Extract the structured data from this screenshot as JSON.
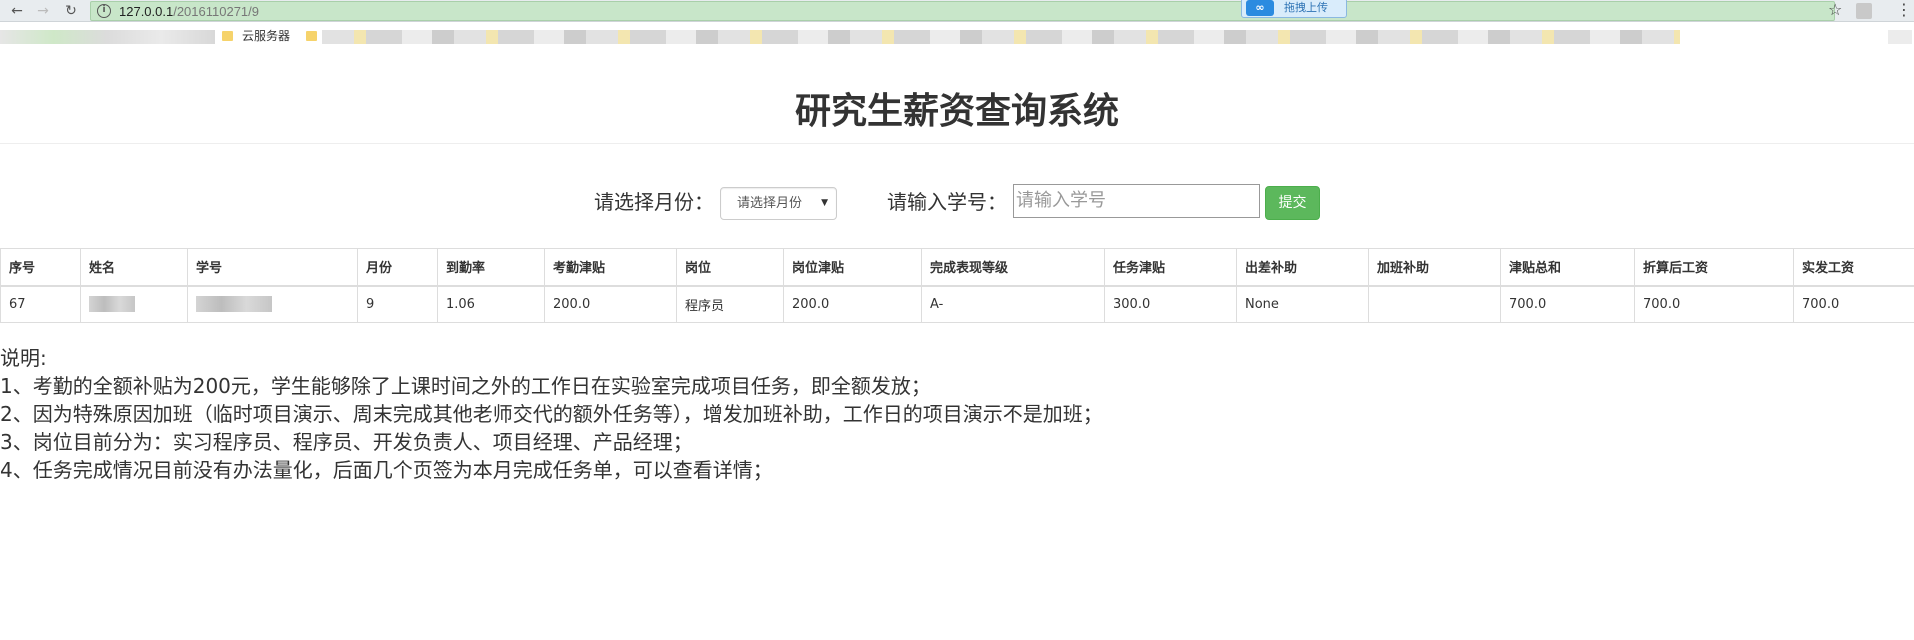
{
  "browser": {
    "url_host": "127.0.0.1",
    "url_path": "/2016110271/9",
    "upload_label": "拖拽上传",
    "bookmark_label": "云服务器"
  },
  "page": {
    "title": "研究生薪资查询系统"
  },
  "filter": {
    "month_label": "请选择月份：",
    "month_select_value": "请选择月份",
    "id_label": "请输入学号：",
    "id_placeholder": "请输入学号",
    "submit_label": "提交"
  },
  "table": {
    "headers": [
      "序号",
      "姓名",
      "学号",
      "月份",
      "到勤率",
      "考勤津贴",
      "岗位",
      "岗位津贴",
      "完成表现等级",
      "任务津贴",
      "出差补助",
      "加班补助",
      "津贴总和",
      "折算后工资",
      "实发工资"
    ],
    "rows": [
      [
        "67",
        "",
        "",
        "9",
        "1.06",
        "200.0",
        "程序员",
        "200.0",
        "A-",
        "300.0",
        "None",
        "",
        "700.0",
        "700.0",
        "700.0"
      ]
    ]
  },
  "notes": {
    "heading": "说明:",
    "items": [
      "1、考勤的全额补贴为200元，学生能够除了上课时间之外的工作日在实验室完成项目任务，即全额发放；",
      "2、因为特殊原因加班（临时项目演示、周末完成其他老师交代的额外任务等），增发加班补助，工作日的项目演示不是加班；",
      "3、岗位目前分为：实习程序员、程序员、开发负责人、项目经理、产品经理；",
      "4、任务完成情况目前没有办法量化，后面几个页签为本月完成任务单，可以查看详情；"
    ]
  }
}
